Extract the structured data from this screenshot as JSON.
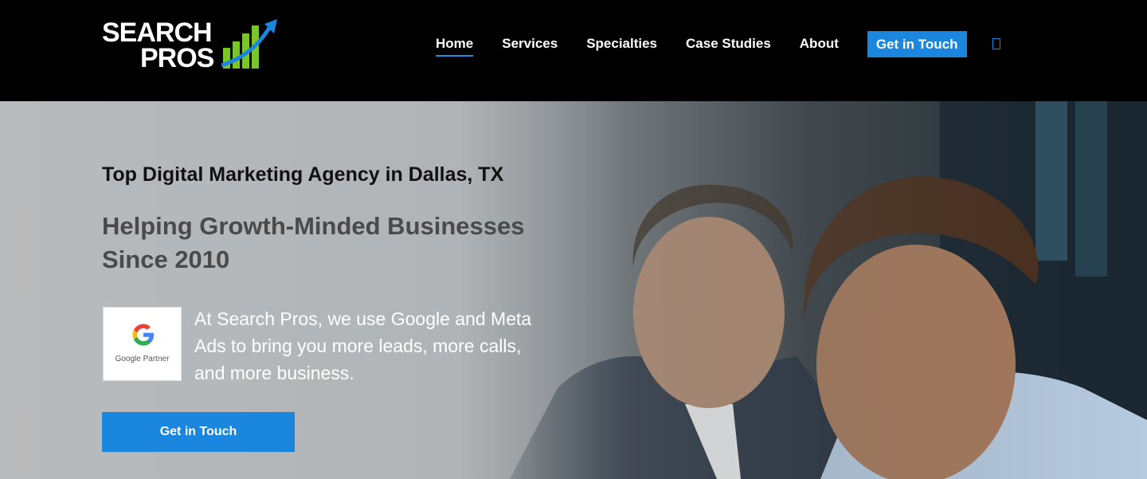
{
  "header": {
    "logo": {
      "line1": "SEARCH",
      "line2": "PROS"
    },
    "nav": [
      {
        "label": "Home",
        "active": true
      },
      {
        "label": "Services",
        "active": false
      },
      {
        "label": "Specialties",
        "active": false
      },
      {
        "label": "Case Studies",
        "active": false
      },
      {
        "label": "About",
        "active": false
      }
    ],
    "cta_label": "Get in Touch",
    "search_icon": "search-icon"
  },
  "hero": {
    "eyebrow": "Top Digital Marketing Agency in Dallas, TX",
    "title": "Helping Growth-Minded Businesses Since 2010",
    "badge": {
      "icon": "google-g-icon",
      "text": "Google Partner"
    },
    "description": "At Search Pros, we use Google and Meta Ads to bring you more leads, more calls, and more business.",
    "cta_label": "Get in Touch"
  },
  "colors": {
    "accent": "#1a86dd",
    "header_bg": "#000000",
    "logo_green": "#7ac62a",
    "logo_arrow": "#1a86dd"
  }
}
